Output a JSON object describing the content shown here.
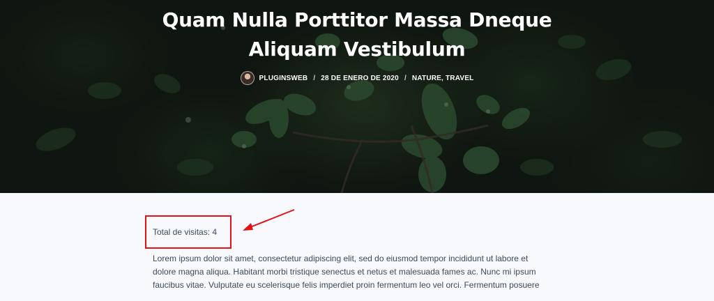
{
  "post": {
    "title_line1": "Quam Nulla Porttitor Massa Dneque",
    "title_line2": "Aliquam Vestibulum",
    "author": "PLUGINSWEB",
    "date": "28 DE ENERO DE 2020",
    "categories": "NATURE, TRAVEL",
    "separator": "/"
  },
  "visits": {
    "text": "Total de visitas: 4"
  },
  "body": {
    "lines": [
      "Lorem ipsum dolor sit amet, consectetur adipiscing elit, sed do eiusmod tempor incididunt ut labore et",
      "dolore magna aliqua. Habitant morbi tristique senectus et netus et malesuada fames ac. Nunc mi ipsum",
      "faucibus vitae. Vulputate eu scelerisque felis imperdiet proin fermentum leo vel orci. Fermentum posuere"
    ]
  },
  "colors": {
    "annotation": "#e3121a",
    "text": "#3c4a5c",
    "hero_bg": "#131a14",
    "page_bg": "#f7f9fc"
  }
}
